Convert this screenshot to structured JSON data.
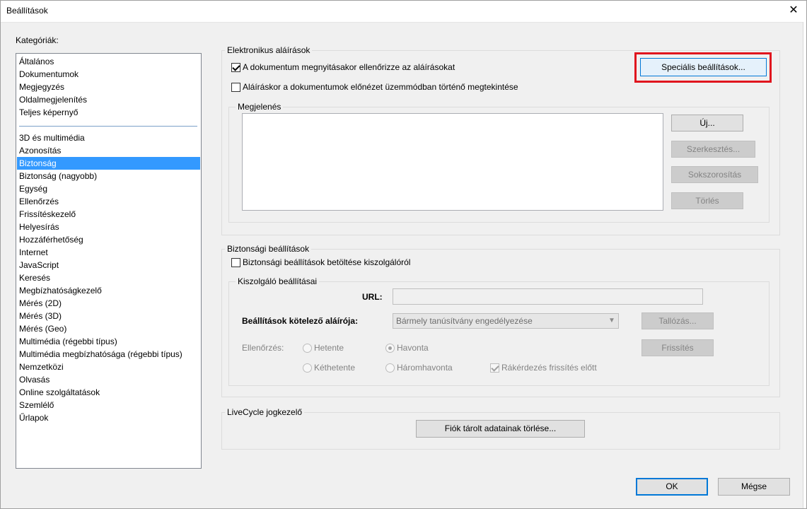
{
  "window": {
    "title": "Beállítások",
    "close_glyph": "✕"
  },
  "categories": {
    "label": "Kategóriák:",
    "group1": [
      "Általános",
      "Dokumentumok",
      "Megjegyzés",
      "Oldalmegjelenítés",
      "Teljes képernyő"
    ],
    "group2": [
      "3D és multimédia",
      "Azonosítás",
      "Biztonság",
      "Biztonság (nagyobb)",
      "Egység",
      "Ellenőrzés",
      "Frissítéskezelő",
      "Helyesírás",
      "Hozzáférhetőség",
      "Internet",
      "JavaScript",
      "Keresés",
      "Megbízhatóságkezelő",
      "Mérés (2D)",
      "Mérés (3D)",
      "Mérés (Geo)",
      "Multimédia (régebbi típus)",
      "Multimédia megbízhatósága (régebbi típus)",
      "Nemzetközi",
      "Olvasás",
      "Online szolgáltatások",
      "Szemlélő",
      "Űrlapok"
    ],
    "selected": "Biztonság"
  },
  "signatures": {
    "title": "Elektronikus aláírások",
    "verify_on_open": "A dokumentum megnyitásakor ellenőrizze az aláírásokat",
    "verify_on_open_checked": true,
    "preview_mode": "Aláíráskor a dokumentumok előnézet üzemmódban történő megtekintése",
    "preview_mode_checked": false,
    "advanced_button": "Speciális beállítások...",
    "appearance": {
      "title": "Megjelenés",
      "new": "Új...",
      "edit": "Szerkesztés...",
      "duplicate": "Sokszorosítás",
      "delete": "Törlés"
    }
  },
  "security": {
    "title": "Biztonsági beállítások",
    "load_from_server": "Biztonsági beállítások betöltése kiszolgálóról",
    "load_from_server_checked": false,
    "server": {
      "title": "Kiszolgáló beállításai",
      "url_label": "URL:",
      "url_value": "",
      "signer_label": "Beállítások kötelező aláírója:",
      "signer_value": "Bármely tanúsítvány engedélyezése",
      "browse": "Tallózás...",
      "refresh": "Frissítés",
      "check_label": "Ellenőrzés:",
      "weekly": "Hetente",
      "monthly": "Havonta",
      "biweekly": "Kéthetente",
      "quarterly": "Háromhavonta",
      "selected_interval": "Havonta",
      "ask_before": "Rákérdezés frissítés előtt",
      "ask_before_checked": true
    }
  },
  "livecycle": {
    "title": "LiveCycle jogkezelő",
    "clear_button": "Fiók tárolt adatainak törlése..."
  },
  "footer": {
    "ok": "OK",
    "cancel": "Mégse"
  },
  "colors": {
    "highlight": "#e0151e",
    "selection": "#3399ff",
    "focus": "#0078d7"
  }
}
